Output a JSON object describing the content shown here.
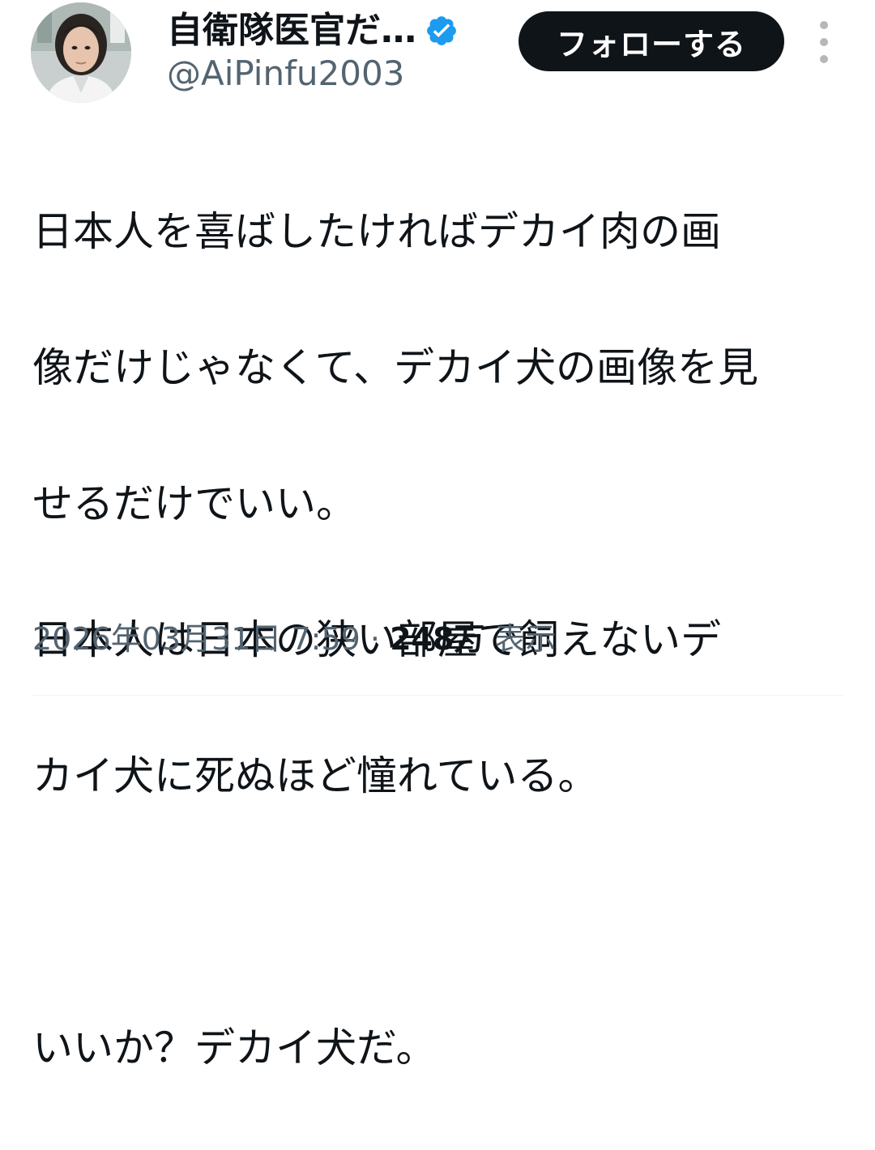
{
  "header": {
    "display_name": "自衛隊医官だ…",
    "handle": "@AiPinfu2003",
    "follow_label": "フォローする",
    "verified_icon": "verified-badge-icon"
  },
  "tweet": {
    "lines": [
      "日本人を喜ばしたければデカイ肉の画",
      "像だけじゃなくて、デカイ犬の画像を見",
      "せるだけでいい。",
      "日本人は日本の狭い部屋で飼えないデ",
      "カイ犬に死ぬほど憧れている。",
      "",
      "いいか？デカイ犬だ。"
    ]
  },
  "meta": {
    "timestamp": "2026年03月31日 7:59",
    "separator": "·",
    "views_count": "248万",
    "views_label": "表示"
  },
  "colors": {
    "primary_text": "#0f1419",
    "secondary_text": "#536471",
    "follow_bg": "#0f1419",
    "follow_text": "#ffffff",
    "verified_blue": "#1d9bf0"
  }
}
